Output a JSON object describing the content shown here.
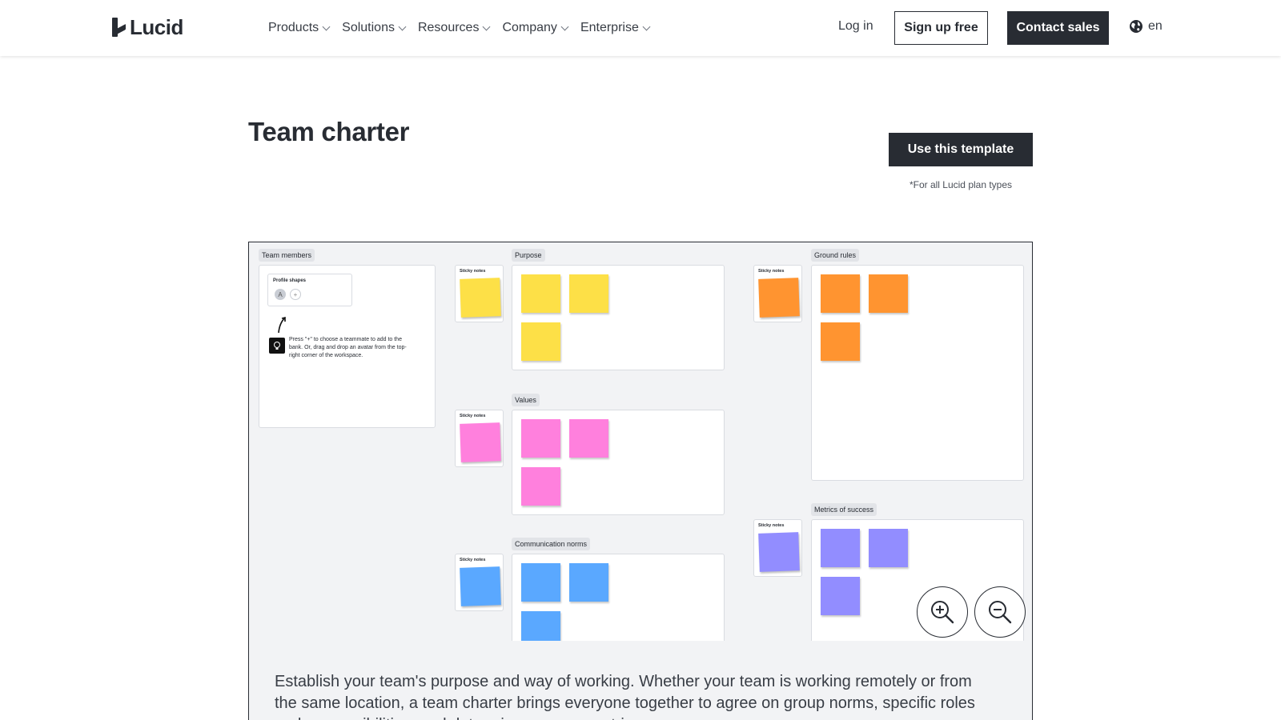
{
  "header": {
    "logo_text": "Lucid",
    "nav": [
      {
        "label": "Products"
      },
      {
        "label": "Solutions"
      },
      {
        "label": "Resources"
      },
      {
        "label": "Company"
      },
      {
        "label": "Enterprise"
      }
    ],
    "login_label": "Log in",
    "signup_label": "Sign up free",
    "contact_label": "Contact sales",
    "language": "en"
  },
  "page": {
    "title": "Team charter",
    "cta_label": "Use this template",
    "plan_note": "*For all Lucid plan types"
  },
  "canvas": {
    "team_members": {
      "label": "Team members",
      "profile_title": "Profile shapes",
      "avatar_letter": "A",
      "add_symbol": "+",
      "hint": "Press \"+\" to choose a teammate to add to the bank. Or, drag and drop an avatar from the top-right corner of the workspace."
    },
    "sticky_label": "Sticky notes",
    "sections": [
      {
        "label": "Purpose",
        "color": "#fde047"
      },
      {
        "label": "Values",
        "color": "#ff80dd"
      },
      {
        "label": "Communication norms",
        "color": "#5aa8ff"
      },
      {
        "label": "Ground rules",
        "color": "#ff9430"
      },
      {
        "label": "Metrics of success",
        "color": "#928dff"
      }
    ],
    "zoom_in_icon": "zoom-in-icon",
    "zoom_out_icon": "zoom-out-icon"
  },
  "description": "Establish your team's purpose and way of working. Whether your team is working remotely or from the same location, a team charter brings everyone together to agree on group norms, specific roles and responsibilities, and determine success metrics."
}
